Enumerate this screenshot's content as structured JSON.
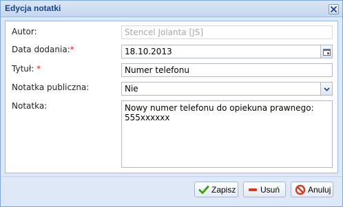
{
  "window": {
    "title": "Edycja notatki"
  },
  "form": {
    "author": {
      "label": "Autor:",
      "value": "Stencel Jolanta  [JS]"
    },
    "date": {
      "label": "Data dodania:",
      "required_mark": "*",
      "value": "18.10.2013"
    },
    "title": {
      "label": "Tytuł:",
      "required_mark": "*",
      "value": "Numer telefonu"
    },
    "public": {
      "label": "Notatka publiczna:",
      "value": "Nie"
    },
    "note": {
      "label": "Notatka:",
      "value": "Nowy numer telefonu do opiekuna prawnego:\n555xxxxxx"
    }
  },
  "buttons": {
    "save": "Zapisz",
    "delete": "Usuń",
    "cancel": "Anuluj"
  },
  "colors": {
    "title_text": "#15428b",
    "required": "#d62020",
    "save_icon": "#3aa316",
    "delete_icon": "#d23b1e",
    "cancel_icon": "#d23b1e"
  },
  "icons": {
    "close": "close-icon",
    "calendar": "calendar-icon",
    "dropdown": "chevron-down-icon",
    "save": "check-icon",
    "delete": "minus-icon",
    "cancel": "no-entry-icon"
  }
}
